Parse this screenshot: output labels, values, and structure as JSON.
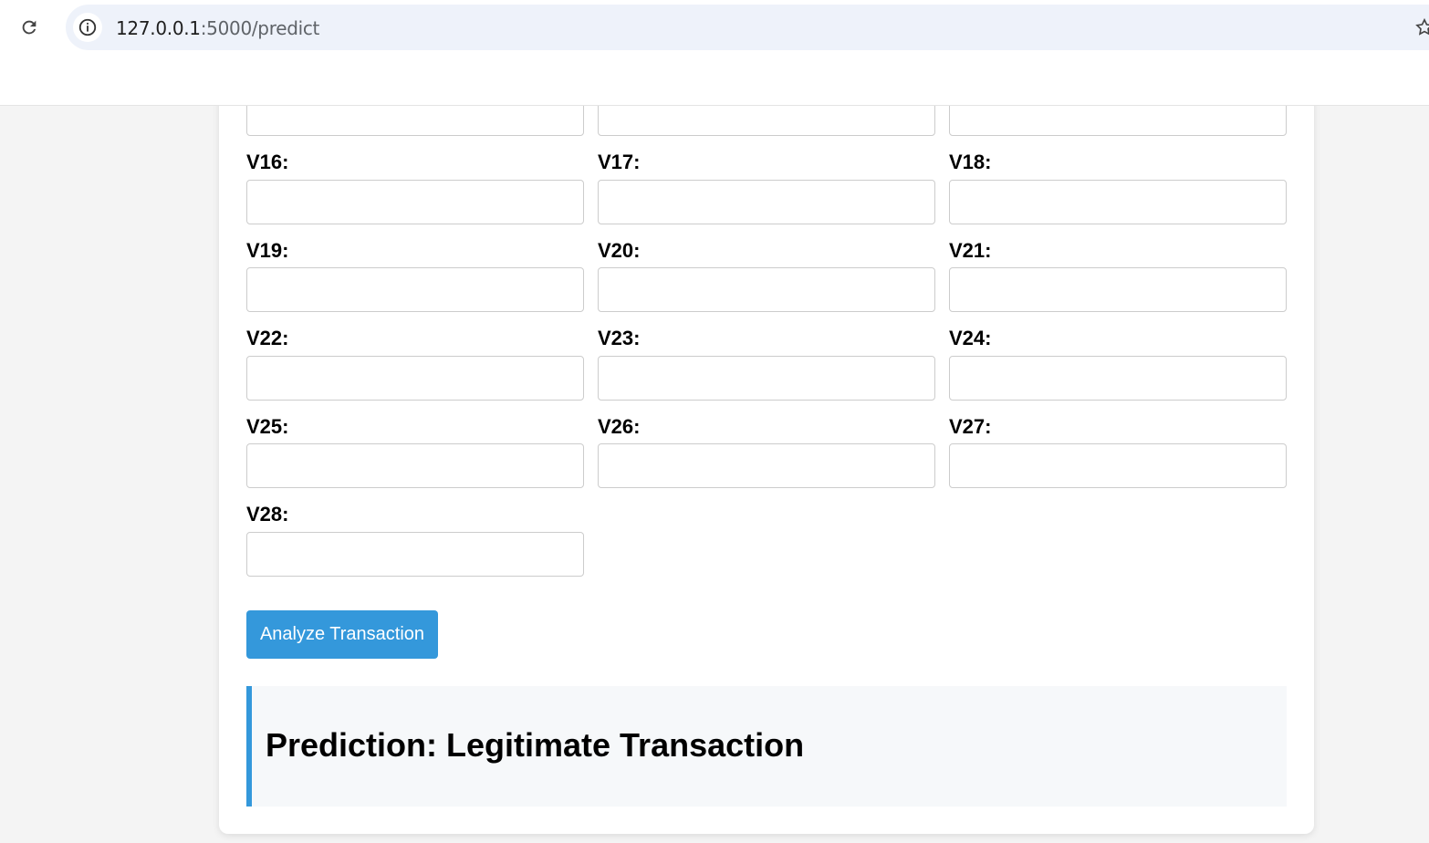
{
  "browser": {
    "url_host": "127.0.0.1",
    "url_rest": ":5000/predict"
  },
  "form": {
    "partial_row": [
      "",
      "",
      ""
    ],
    "fields": [
      {
        "label": "V16:",
        "value": ""
      },
      {
        "label": "V17:",
        "value": ""
      },
      {
        "label": "V18:",
        "value": ""
      },
      {
        "label": "V19:",
        "value": ""
      },
      {
        "label": "V20:",
        "value": ""
      },
      {
        "label": "V21:",
        "value": ""
      },
      {
        "label": "V22:",
        "value": ""
      },
      {
        "label": "V23:",
        "value": ""
      },
      {
        "label": "V24:",
        "value": ""
      },
      {
        "label": "V25:",
        "value": ""
      },
      {
        "label": "V26:",
        "value": ""
      },
      {
        "label": "V27:",
        "value": ""
      },
      {
        "label": "V28:",
        "value": ""
      }
    ],
    "submit_label": "Analyze Transaction"
  },
  "result": {
    "text": "Prediction: Legitimate Transaction"
  },
  "colors": {
    "accent": "#3498db",
    "result_bg": "#f6f8fa"
  }
}
